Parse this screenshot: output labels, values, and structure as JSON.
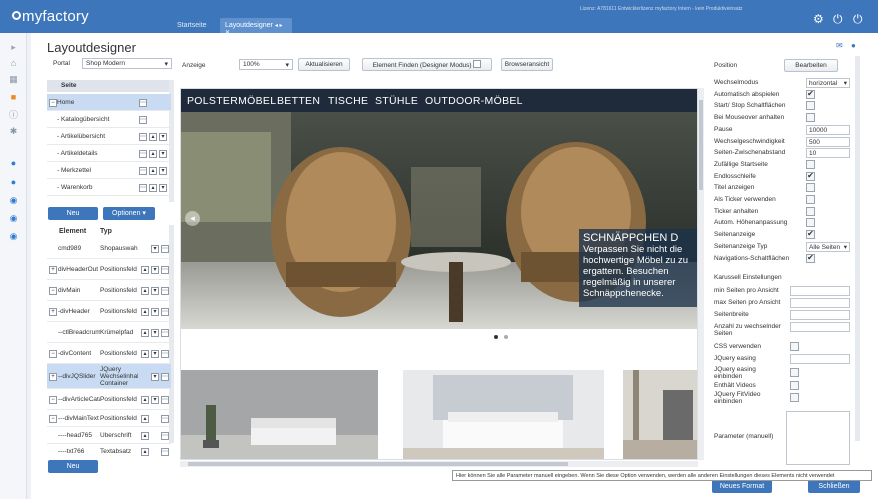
{
  "app": {
    "logo": "myfactory",
    "license": "Lizenz: A781611 Entwicklerlizenz myfactory Intern - kein Produktiveinsatz"
  },
  "tabs": [
    {
      "label": "Startseite"
    },
    {
      "label": "Layoutdesigner"
    }
  ],
  "page": {
    "title": "Layoutdesigner"
  },
  "toolbar": {
    "portal_label": "Portal",
    "portal_value": "Shop Modern",
    "anzeige_label": "Anzeige",
    "zoom_value": "100%",
    "refresh_label": "Aktualisieren",
    "find_label": "Element Finden (Designer Modus)",
    "browser_label": "Browseransicht"
  },
  "tree": {
    "header": "Seite",
    "rows": [
      {
        "label": "Home"
      },
      {
        "label": "- Katalogübersicht"
      },
      {
        "label": "- Artikelübersicht"
      },
      {
        "label": "- Artikeldetails"
      },
      {
        "label": "- Merkzettel"
      },
      {
        "label": "- Warenkorb"
      }
    ],
    "new_label": "Neu",
    "options_label": "Optionen"
  },
  "elements": {
    "header_name": "Element",
    "header_type": "Typ",
    "rows": [
      {
        "name": "cmd989",
        "type": "Shopauswahl"
      },
      {
        "name": "divHeaderOut",
        "type": "Positionsfeld"
      },
      {
        "name": "divMain",
        "type": "Positionsfeld"
      },
      {
        "name": "-divHeader",
        "type": "Positionsfeld"
      },
      {
        "name": "--ctlBreadcrumb",
        "type": "Krümelpfad"
      },
      {
        "name": "-divContent",
        "type": "Positionsfeld"
      },
      {
        "name": "--divJQSlider",
        "type": "JQuery Wechselinhalt Container"
      },
      {
        "name": "--divArticleCata",
        "type": "Positionsfeld"
      },
      {
        "name": "---divMainText",
        "type": "Positionsfeld"
      },
      {
        "name": "----head765",
        "type": "Überschrift"
      },
      {
        "name": "----txt766",
        "type": "Textabsatz"
      }
    ],
    "new_label": "Neu"
  },
  "preview": {
    "nav": [
      "POLSTERMÖBEL",
      "BETTEN",
      "TISCHE",
      "STÜHLE",
      "OUTDOOR-MÖBEL"
    ],
    "promo_title": "SCHNÄPPCHEN D",
    "promo_text": "Verpassen Sie nicht die hochwertige Möbel zu zu ergattern. Besuchen regelmäßig in unserer Schnäppchenecke."
  },
  "properties": {
    "position_label": "Position",
    "edit_label": "Bearbeiten",
    "rows": [
      {
        "label": "Wechselmodus",
        "kind": "select",
        "value": "horizontal"
      },
      {
        "label": "Automatisch abspielen",
        "kind": "check",
        "value": "✔"
      },
      {
        "label": "Start/ Stop Schaltflächen",
        "kind": "check",
        "value": ""
      },
      {
        "label": "Bei Mouseover anhalten",
        "kind": "check",
        "value": ""
      },
      {
        "label": "Pause",
        "kind": "input",
        "value": "10000"
      },
      {
        "label": "Wechselgeschwindigkeit",
        "kind": "input",
        "value": "500"
      },
      {
        "label": "Seiten-Zwischenabstand",
        "kind": "input",
        "value": "10"
      },
      {
        "label": "Zufällige Startseite",
        "kind": "check",
        "value": ""
      },
      {
        "label": "Endlosschleife",
        "kind": "check",
        "value": "✔"
      },
      {
        "label": "Titel anzeigen",
        "kind": "check",
        "value": ""
      },
      {
        "label": "Als Ticker verwenden",
        "kind": "check",
        "value": ""
      },
      {
        "label": "Ticker anhalten",
        "kind": "check",
        "value": ""
      },
      {
        "label": "Autom. Höhenanpassung",
        "kind": "check",
        "value": ""
      },
      {
        "label": "Seitenanzeige",
        "kind": "check",
        "value": "✔"
      },
      {
        "label": "Seitenanzeige Typ",
        "kind": "select",
        "value": "Alle Seiten"
      },
      {
        "label": "Navigations-Schaltflächen",
        "kind": "check",
        "value": "✔"
      }
    ],
    "carousel_label": "Karussell Einstellungen",
    "carousel_rows": [
      {
        "label": "min Seiten pro Ansicht"
      },
      {
        "label": "max Seiten pro Ansicht"
      },
      {
        "label": "Seitenbreite"
      },
      {
        "label": "Anzahl zu wechselnder Seiten"
      }
    ],
    "css_label": "CSS verwenden",
    "jq_easing": "JQuery easing",
    "jq_easing_embed": "JQuery easing einbinden",
    "contains_videos": "Enthält Videos",
    "fitvideo": "JQuery FitVideo einbinden",
    "params_label": "Parameter (manuell)",
    "new_format": "Neues Format",
    "close_label": "Schließen"
  },
  "tooltip": "Hier können Sie alle Parameter manuell eingeben. Wenn Sie diese Option verwenden, werden alle anderen Einstellungen dieses Elements nicht verwendet"
}
